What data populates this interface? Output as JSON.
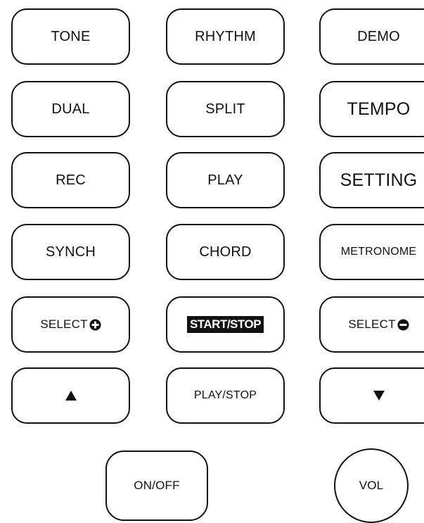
{
  "buttons": {
    "tone": "TONE",
    "rhythm": "RHYTHM",
    "demo": "DEMO",
    "dual": "DUAL",
    "split": "SPLIT",
    "tempo": "TEMPO",
    "rec": "REC",
    "play": "PLAY",
    "setting": "SETTING",
    "synch": "SYNCH",
    "chord": "CHORD",
    "metronome": "METRONOME",
    "select_plus": "SELECT",
    "start_stop": "START/STOP",
    "select_minus": "SELECT",
    "play_stop": "PLAY/STOP",
    "on_off": "ON/OFF",
    "vol": "VOL"
  },
  "icons": {
    "plus": "plus-circle-icon",
    "minus": "minus-circle-icon",
    "up": "up-triangle-icon",
    "down": "down-triangle-icon"
  }
}
